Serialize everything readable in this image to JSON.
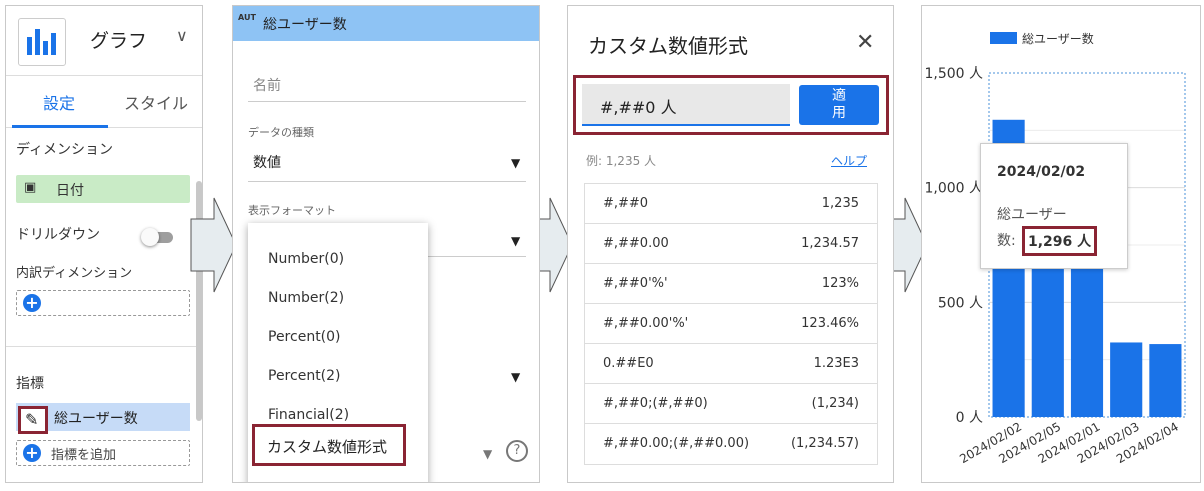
{
  "panel1": {
    "chart_type": "グラフ",
    "tabs": [
      "設定",
      "スタイル"
    ],
    "dimension_label": "ディメンション",
    "dimension_chip": "日付",
    "drilldown_label": "ドリルダウン",
    "breakdown_label": "内訳ディメンション",
    "metric_label": "指標",
    "metric_chip": "総ユーザー数",
    "add_metric": "指標を追加",
    "accent": "#1a73e8"
  },
  "panel2": {
    "badge": "AUT",
    "header": "総ユーザー数",
    "name_placeholder": "名前",
    "data_type_label": "データの種類",
    "data_type_value": "数値",
    "display_format_label": "表示フォーマット",
    "options": [
      "Number(0)",
      "Number(2)",
      "Percent(0)",
      "Percent(2)",
      "Financial(2)",
      "カスタム数値形式"
    ],
    "help_icon": "?"
  },
  "panel3": {
    "title": "カスタム数値形式",
    "close": "✕",
    "input_value": "#,##0 人",
    "apply_line1": "適",
    "apply_line2": "用",
    "example": "例: 1,235 人",
    "help_link": "ヘルプ",
    "formats": [
      {
        "pattern": "#,##0",
        "example": "1,235"
      },
      {
        "pattern": "#,##0.00",
        "example": "1,234.57"
      },
      {
        "pattern": "#,##0'%'",
        "example": "123%"
      },
      {
        "pattern": "#,##0.00'%'",
        "example": "123.46%"
      },
      {
        "pattern": "0.##E0",
        "example": "1.23E3"
      },
      {
        "pattern": "#,##0;(#,##0)",
        "example": "(1,234)"
      },
      {
        "pattern": "#,##0.00;(#,##0.00)",
        "example": "(1,234.57)"
      }
    ]
  },
  "chart_data": {
    "type": "bar",
    "categories": [
      "2024/02/02",
      "2024/02/05",
      "2024/02/01",
      "2024/02/03",
      "2024/02/04"
    ],
    "series": [
      {
        "name": "総ユーザー数",
        "values": [
          1296,
          670,
          675,
          325,
          318
        ],
        "color": "#1a73e8"
      }
    ],
    "yticks": [
      "0 人",
      "500 人",
      "1,000 人",
      "1,500 人"
    ],
    "ylim": [
      0,
      1500
    ],
    "grid": true,
    "legend": "top"
  },
  "tooltip": {
    "date": "2024/02/02",
    "name_line1": "総ユーザー",
    "name_line2": "数:",
    "value": "1,296 人"
  }
}
